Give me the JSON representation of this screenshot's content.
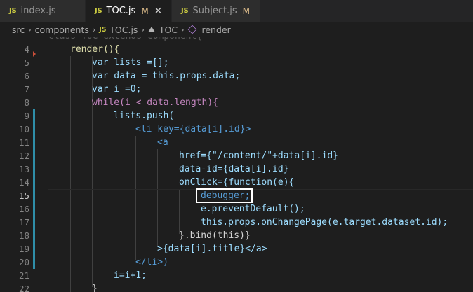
{
  "tabs": [
    {
      "label": "index.js",
      "badge": "JS",
      "modified": "",
      "active": false
    },
    {
      "label": "TOC.js",
      "badge": "JS",
      "modified": "M",
      "active": true
    },
    {
      "label": "Subject.js",
      "badge": "JS",
      "modified": "M",
      "active": false
    }
  ],
  "breadcrumb": {
    "parts": [
      "src",
      "components",
      "TOC.js",
      "TOC",
      "render"
    ],
    "badge": "JS"
  },
  "icons": {
    "close": "close-icon",
    "method": "method-cube-icon",
    "class": "class-icon"
  },
  "colors": {
    "accent_badge": "#cbcb41",
    "modified": "#e2c08d",
    "gutter_change": "#2f8ea8"
  },
  "editor": {
    "top_partial": "class TOC extends Component{",
    "line_numbers": [
      "4",
      "5",
      "6",
      "7",
      "8",
      "9",
      "10",
      "11",
      "12",
      "13",
      "14",
      "15",
      "16",
      "17",
      "18",
      "19",
      "20",
      "21",
      "22"
    ],
    "current_line": "15",
    "lines": [
      "render(){",
      "var lists =[];",
      "var data = this.props.data;",
      "var i =0;",
      "while(i < data.length){",
      "lists.push(",
      "<li key={data[i].id}>",
      "<a",
      "href={\"/content/\"+data[i].id}",
      "data-id={data[i].id}",
      "onClick={function(e){",
      "debugger;",
      "e.preventDefault();",
      "this.props.onChangePage(e.target.dataset.id);",
      "}.bind(this)}",
      ">{data[i].title}</a>",
      "</li>)",
      "i=i+1;",
      "}"
    ]
  }
}
